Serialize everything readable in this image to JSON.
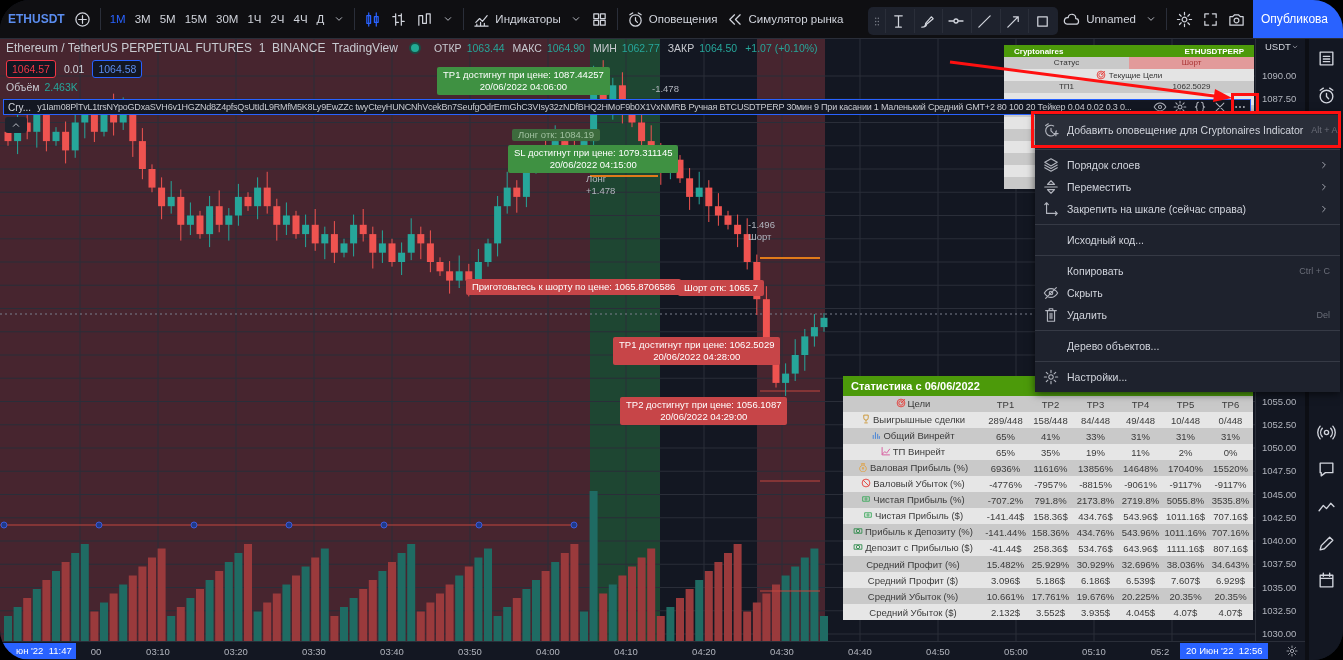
{
  "toolbar": {
    "symbol": "ETHUSDT",
    "intervals": [
      {
        "label": "1М",
        "selected": true
      },
      {
        "label": "3М",
        "selected": false
      },
      {
        "label": "5М",
        "selected": false
      },
      {
        "label": "15М",
        "selected": false
      },
      {
        "label": "30М",
        "selected": false
      },
      {
        "label": "1Ч",
        "selected": false
      },
      {
        "label": "2Ч",
        "selected": false
      },
      {
        "label": "4Ч",
        "selected": false
      },
      {
        "label": "Д",
        "selected": false
      }
    ],
    "indicators_button": "Индикаторы",
    "alerts_button": "Оповещения",
    "replay_button": "Симулятор рынка",
    "layout_name": "Unnamed",
    "publish_button": "Опубликова"
  },
  "legend": {
    "title": "Ethereum / TetherUS PERPETUAL FUTURES  1  BINANCE  TradingView",
    "ohlc": [
      {
        "label": "ОТКР",
        "value": "1063.44"
      },
      {
        "label": "МАКС",
        "value": "1064.90"
      },
      {
        "label": "МИН",
        "value": "1062.77"
      },
      {
        "label": "ЗАКР",
        "value": "1064.50"
      }
    ],
    "change": "+1.07 (+0.10%)",
    "sell_price": "1064.57",
    "spread": "0.01",
    "buy_price": "1064.58",
    "volume_label": "Объём",
    "volume_value": "2.463K",
    "indicator_name": "Cry...",
    "indicator_settings": "y1Iam08PlTvL1trsNYpoGDxaSVH6v1HGZNd8Z4pfsQsUtIdL9RMfM5K8Ly9EwZZc twyCteyHUNCNhVcekBn7SeufgOdrErmGhC3VIsy32zNDfBHQ2HMoF9b0X1VxNMRB Ручная BTCUSDTPERP 30мин 9 При касании 1 Маленький Средний GMT+2 80 100 20 Тейкер 0.04 0.02 0.3 0..."
  },
  "chart_labels": [
    {
      "kind": "long",
      "text": "TP1 достигнут при цене: 1087.44257",
      "subtext": "20/06/2022 04:06:00"
    },
    {
      "kind": "note",
      "text": "-1.478"
    },
    {
      "kind": "faded",
      "text": "Лонг отк: 1084.19"
    },
    {
      "kind": "long",
      "text": "SL достигнут при цене: 1079.311145",
      "subtext": "20/06/2022 04:15:00"
    },
    {
      "kind": "note",
      "text": "Лонг",
      "subtext": "+1.478"
    },
    {
      "kind": "note",
      "text": "-1.496",
      "subtext": "Шорт"
    },
    {
      "kind": "short",
      "text": "Приготовьтесь к шорту по цене: 1065.8706586"
    },
    {
      "kind": "short",
      "text": "Шорт отк: 1065.7"
    },
    {
      "kind": "short",
      "text": "TP1 достигнут при цене: 1062.5029",
      "subtext": "20/06/2022 04:28:00"
    },
    {
      "kind": "short",
      "text": "TP2 достигнут при цене: 1056.1087",
      "subtext": "20/06/2022 04:29:00"
    }
  ],
  "info_table": {
    "header": [
      "Cryptonaires",
      "ETHUSDTPERP"
    ],
    "rows": [
      {
        "kind": "status",
        "cells": [
          "Статус",
          "Шорт"
        ]
      },
      {
        "kind": "heading",
        "cells": [
          "Текущие  Цели"
        ]
      },
      {
        "kind": "pair",
        "cells": [
          "ТП1",
          "1062.5029"
        ]
      }
    ]
  },
  "stats_table": {
    "title": "Статистика с 06/06/2022",
    "columns": [
      "Цели",
      "TP1",
      "TP2",
      "TP3",
      "TP4",
      "TP5",
      "TP6"
    ],
    "rows": [
      {
        "label": "Выигрышные сделки",
        "values": [
          "289/448",
          "158/448",
          "84/448",
          "49/448",
          "10/448",
          "0/448"
        ]
      },
      {
        "label": "Общий Винрейт",
        "values": [
          "65%",
          "41%",
          "33%",
          "31%",
          "31%",
          "31%"
        ]
      },
      {
        "label": "ТП Винрейт",
        "values": [
          "65%",
          "35%",
          "19%",
          "11%",
          "2%",
          "0%"
        ]
      },
      {
        "label": "Валовая Прибыль (%)",
        "values": [
          "6936%",
          "11616%",
          "13856%",
          "14648%",
          "17040%",
          "15520%"
        ]
      },
      {
        "label": "Валовый Убыток (%)",
        "values": [
          "-4776%",
          "-7957%",
          "-8815%",
          "-9061%",
          "-9117%",
          "-9117%"
        ]
      },
      {
        "label": "Чистая Прибыль (%)",
        "values": [
          "-707.2%",
          "791.8%",
          "2173.8%",
          "2719.8%",
          "5055.8%",
          "3535.8%"
        ]
      },
      {
        "label": "Чистая Прибыль ($)",
        "values": [
          "-141.44$",
          "158.36$",
          "434.76$",
          "543.96$",
          "1011.16$",
          "707.16$"
        ]
      },
      {
        "label": "Прибыль к Депозиту (%)",
        "values": [
          "-141.44%",
          "158.36%",
          "434.76%",
          "543.96%",
          "1011.16%",
          "707.16%"
        ]
      },
      {
        "label": "Депозит с Прибылью ($)",
        "values": [
          "-41.44$",
          "258.36$",
          "534.76$",
          "643.96$",
          "1111.16$",
          "807.16$"
        ]
      },
      {
        "label": "Средний Профит (%)",
        "values": [
          "15.482%",
          "25.929%",
          "30.929%",
          "32.696%",
          "38.036%",
          "34.643%"
        ]
      },
      {
        "label": "Средний Профит ($)",
        "values": [
          "3.096$",
          "5.186$",
          "6.186$",
          "6.539$",
          "7.607$",
          "6.929$"
        ]
      },
      {
        "label": "Средний Убыток (%)",
        "values": [
          "10.661%",
          "17.761%",
          "19.676%",
          "20.225%",
          "20.35%",
          "20.35%"
        ]
      },
      {
        "label": "Средний Убыток ($)",
        "values": [
          "2.132$",
          "3.552$",
          "3.935$",
          "4.045$",
          "4.07$",
          "4.07$"
        ]
      }
    ]
  },
  "context_menu": {
    "items": [
      {
        "kind": "item",
        "label": "Добавить оповещение для Cryptonaires Indicator",
        "shortcut": "Alt + A",
        "submenu": false,
        "highlighted": true
      },
      {
        "kind": "separator"
      },
      {
        "kind": "item",
        "label": "Порядок слоев",
        "submenu": true,
        "highlighted": false
      },
      {
        "kind": "item",
        "label": "Переместить",
        "submenu": true,
        "highlighted": false
      },
      {
        "kind": "item",
        "label": "Закрепить на шкале (сейчас справа)",
        "submenu": true,
        "highlighted": false
      },
      {
        "kind": "separator"
      },
      {
        "kind": "item",
        "label": "Исходный код...",
        "submenu": false,
        "highlighted": false
      },
      {
        "kind": "separator"
      },
      {
        "kind": "item",
        "label": "Копировать",
        "shortcut": "Ctrl + C",
        "submenu": false,
        "highlighted": false
      },
      {
        "kind": "item",
        "label": "Скрыть",
        "submenu": false,
        "highlighted": false
      },
      {
        "kind": "item",
        "label": "Удалить",
        "shortcut": "Del",
        "submenu": false,
        "highlighted": false
      },
      {
        "kind": "separator"
      },
      {
        "kind": "item",
        "label": "Дерево объектов...",
        "submenu": false,
        "highlighted": false
      },
      {
        "kind": "separator"
      },
      {
        "kind": "item",
        "label": "Настройки...",
        "submenu": false,
        "highlighted": false
      }
    ]
  },
  "price_axis": {
    "currency": "USDT",
    "labels": [
      "1090.00",
      "1087.50",
      "1055.00",
      "1052.50",
      "1050.00",
      "1047.50",
      "1045.00",
      "1042.50",
      "1040.00",
      "1037.50",
      "1035.00",
      "1032.50",
      "1030.00"
    ]
  },
  "time_axis": {
    "start_badge": "юн '22  11:47",
    "labels": [
      "00",
      "03:10",
      "03:20",
      "03:30",
      "03:40",
      "03:50",
      "04:00",
      "04:10",
      "04:20",
      "04:30",
      "04:40",
      "04:50",
      "05:00",
      "05:10",
      "05:2"
    ],
    "end_badge": "20 Июн '22  12:56"
  }
}
